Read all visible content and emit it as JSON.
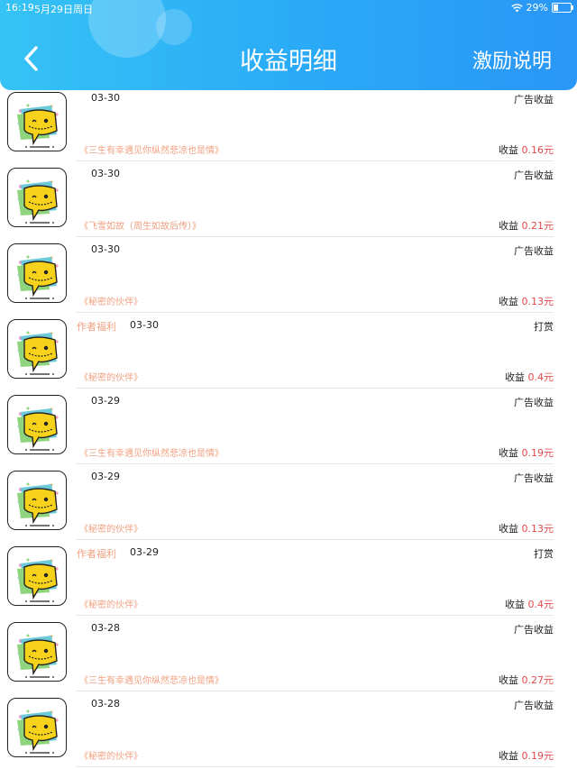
{
  "status_bar": {
    "time": "16:19",
    "date": "5月29日周日",
    "battery": "29%",
    "battery_level": 0.29,
    "wifi_icon": "wifi-icon"
  },
  "header": {
    "title": "收益明细",
    "right_link": "激励说明",
    "back_icon": "chevron-left-icon",
    "gradient_start": "#35c3f5",
    "gradient_end": "#2a96f6"
  },
  "records": [
    {
      "author_tag": "",
      "date": "03-30",
      "type": "广告收益",
      "book": "《三生有幸遇见你纵然悲凉也是情》",
      "earn_label": "收益",
      "amount": "0.16元"
    },
    {
      "author_tag": "",
      "date": "03-30",
      "type": "广告收益",
      "book": "《飞雪如故（周生如故后传）》",
      "earn_label": "收益",
      "amount": "0.21元"
    },
    {
      "author_tag": "",
      "date": "03-30",
      "type": "广告收益",
      "book": "《秘密的伙伴》",
      "earn_label": "收益",
      "amount": "0.13元"
    },
    {
      "author_tag": "作者福利",
      "date": "03-30",
      "type": "打赏",
      "book": "《秘密的伙伴》",
      "earn_label": "收益",
      "amount": "0.4元"
    },
    {
      "author_tag": "",
      "date": "03-29",
      "type": "广告收益",
      "book": "《三生有幸遇见你纵然悲凉也是情》",
      "earn_label": "收益",
      "amount": "0.19元"
    },
    {
      "author_tag": "",
      "date": "03-29",
      "type": "广告收益",
      "book": "《秘密的伙伴》",
      "earn_label": "收益",
      "amount": "0.13元"
    },
    {
      "author_tag": "作者福利",
      "date": "03-29",
      "type": "打赏",
      "book": "《秘密的伙伴》",
      "earn_label": "收益",
      "amount": "0.4元"
    },
    {
      "author_tag": "",
      "date": "03-28",
      "type": "广告收益",
      "book": "《三生有幸遇见你纵然悲凉也是情》",
      "earn_label": "收益",
      "amount": "0.27元"
    },
    {
      "author_tag": "",
      "date": "03-28",
      "type": "广告收益",
      "book": "《秘密的伙伴》",
      "earn_label": "收益",
      "amount": "0.19元"
    }
  ],
  "colors": {
    "accent_text": "#f0a181",
    "amount": "#e24b4b",
    "mascot_yellow": "#f7d21a"
  }
}
